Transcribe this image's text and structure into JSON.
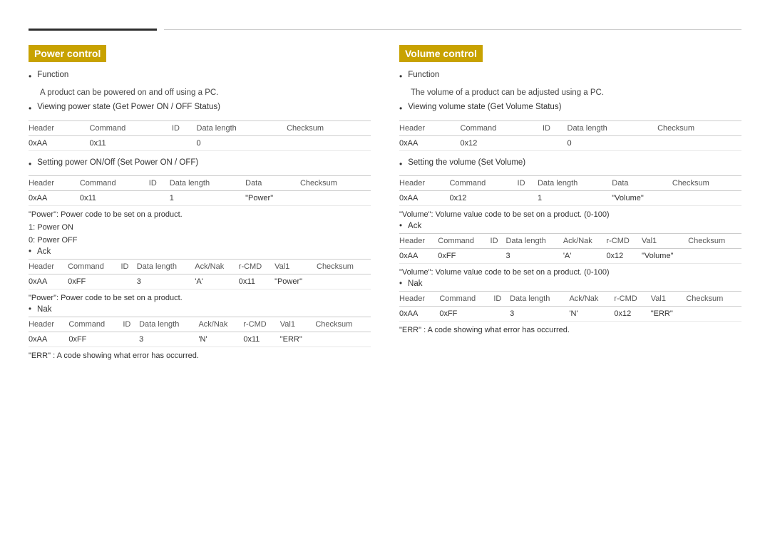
{
  "topLine": true,
  "leftSection": {
    "title": "Power control",
    "function_label": "Function",
    "function_desc": "A product can be powered on and off using a PC.",
    "viewing_label": "Viewing power state (Get Power ON / OFF Status)",
    "viewing_table": {
      "headers": [
        "Header",
        "Command",
        "ID",
        "Data length",
        "Checksum"
      ],
      "rows": [
        [
          "0xAA",
          "0x11",
          "",
          "0",
          ""
        ]
      ]
    },
    "setting_label": "Setting power ON/Off (Set Power ON / OFF)",
    "setting_table": {
      "headers": [
        "Header",
        "Command",
        "ID",
        "Data length",
        "Data",
        "Checksum"
      ],
      "rows": [
        [
          "0xAA",
          "0x11",
          "",
          "1",
          "\"Power\"",
          ""
        ]
      ]
    },
    "power_note1": "\"Power\": Power code to be set on a product.",
    "power_on": "1: Power ON",
    "power_off": "0: Power OFF",
    "ack_label": "Ack",
    "ack_table": {
      "headers": [
        "Header",
        "Command",
        "ID",
        "Data length",
        "Ack/Nak",
        "r-CMD",
        "Val1",
        "Checksum"
      ],
      "rows": [
        [
          "0xAA",
          "0xFF",
          "",
          "3",
          "'A'",
          "0x11",
          "\"Power\"",
          ""
        ]
      ]
    },
    "power_note2": "\"Power\": Power code to be set on a product.",
    "nak_label": "Nak",
    "nak_table": {
      "headers": [
        "Header",
        "Command",
        "ID",
        "Data length",
        "Ack/Nak",
        "r-CMD",
        "Val1",
        "Checksum"
      ],
      "rows": [
        [
          "0xAA",
          "0xFF",
          "",
          "3",
          "'N'",
          "0x11",
          "\"ERR\"",
          ""
        ]
      ]
    },
    "err_note": "\"ERR\" : A code showing what error has occurred."
  },
  "rightSection": {
    "title": "Volume control",
    "function_label": "Function",
    "function_desc": "The volume of a product can be adjusted using a PC.",
    "viewing_label": "Viewing volume state (Get Volume Status)",
    "viewing_table": {
      "headers": [
        "Header",
        "Command",
        "ID",
        "Data length",
        "Checksum"
      ],
      "rows": [
        [
          "0xAA",
          "0x12",
          "",
          "0",
          ""
        ]
      ]
    },
    "setting_label": "Setting the volume (Set Volume)",
    "setting_table": {
      "headers": [
        "Header",
        "Command",
        "ID",
        "Data length",
        "Data",
        "Checksum"
      ],
      "rows": [
        [
          "0xAA",
          "0x12",
          "",
          "1",
          "\"Volume\"",
          ""
        ]
      ]
    },
    "volume_note1": "\"Volume\": Volume value code to be set on a product. (0-100)",
    "ack_label": "Ack",
    "ack_table": {
      "headers": [
        "Header",
        "Command",
        "ID",
        "Data length",
        "Ack/Nak",
        "r-CMD",
        "Val1",
        "Checksum"
      ],
      "rows": [
        [
          "0xAA",
          "0xFF",
          "",
          "3",
          "'A'",
          "0x12",
          "\"Volume\"",
          ""
        ]
      ]
    },
    "volume_note2": "\"Volume\": Volume value code to be set on a product. (0-100)",
    "nak_label": "Nak",
    "nak_table": {
      "headers": [
        "Header",
        "Command",
        "ID",
        "Data length",
        "Ack/Nak",
        "r-CMD",
        "Val1",
        "Checksum"
      ],
      "rows": [
        [
          "0xAA",
          "0xFF",
          "",
          "3",
          "'N'",
          "0x12",
          "\"ERR\"",
          ""
        ]
      ]
    },
    "err_note": "\"ERR\" : A code showing what error has occurred."
  }
}
